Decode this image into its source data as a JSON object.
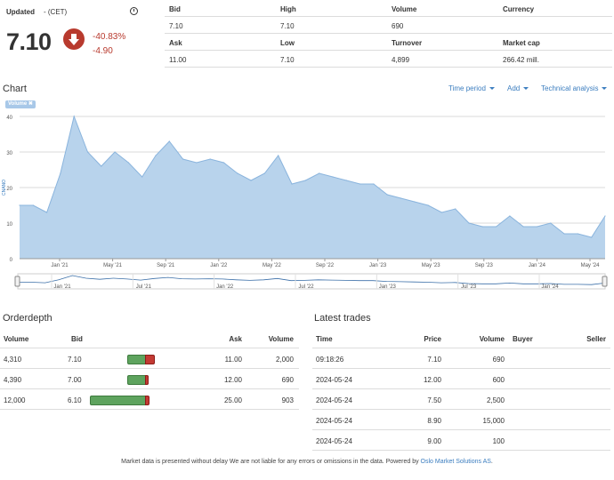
{
  "quote": {
    "updated_label": "Updated",
    "timezone": "- (CET)",
    "last": "7.10",
    "change_pct": "-40.83%",
    "change_abs": "-4.90",
    "headers_1": [
      "Bid",
      "High",
      "Volume",
      "Currency"
    ],
    "values_1": [
      "7.10",
      "7.10",
      "690",
      ""
    ],
    "headers_2": [
      "Ask",
      "Low",
      "Turnover",
      "Market cap"
    ],
    "values_2": [
      "11.00",
      "7.10",
      "4,899",
      "266.42 mill."
    ],
    "down_color": "#b83a2e"
  },
  "chart_section": {
    "title": "Chart",
    "time_period": "Time period",
    "add": "Add",
    "technical_analysis": "Technical analysis",
    "volume_tag": "Volume ✖"
  },
  "chart_data": {
    "type": "area",
    "ylabel": "CNANO",
    "ylim": [
      0,
      40
    ],
    "yticks": [
      0,
      10,
      20,
      30,
      40
    ],
    "x_tick_labels": [
      "Jan '21",
      "May '21",
      "Sep '21",
      "Jan '22",
      "May '22",
      "Sep '22",
      "Jan '23",
      "May '23",
      "Sep '23",
      "Jan '24",
      "May '24"
    ],
    "nav_tick_labels": [
      "Jan '21",
      "Jul '21",
      "Jan '22",
      "Jul '22",
      "Jan '23",
      "Jul '23",
      "Jan '24"
    ],
    "x": [
      "2020-10",
      "2020-11",
      "2020-12",
      "2021-01",
      "2021-02",
      "2021-03",
      "2021-04",
      "2021-05",
      "2021-06",
      "2021-07",
      "2021-08",
      "2021-09",
      "2021-10",
      "2021-11",
      "2021-12",
      "2022-01",
      "2022-02",
      "2022-03",
      "2022-04",
      "2022-05",
      "2022-06",
      "2022-07",
      "2022-08",
      "2022-09",
      "2022-10",
      "2022-11",
      "2022-12",
      "2023-01",
      "2023-02",
      "2023-03",
      "2023-04",
      "2023-05",
      "2023-06",
      "2023-07",
      "2023-08",
      "2023-09",
      "2023-10",
      "2023-11",
      "2023-12",
      "2024-01",
      "2024-02",
      "2024-03",
      "2024-04",
      "2024-05"
    ],
    "values": [
      15,
      15,
      13,
      24,
      40,
      30,
      26,
      30,
      27,
      23,
      29,
      33,
      28,
      27,
      28,
      27,
      24,
      22,
      24,
      29,
      21,
      22,
      24,
      23,
      22,
      21,
      21,
      18,
      17,
      16,
      15,
      13,
      14,
      10,
      9,
      9,
      12,
      9,
      9,
      10,
      7,
      7,
      6,
      12
    ],
    "fill_color": "#b8d3ec",
    "line_color": "#8ab4dd"
  },
  "orderdepth": {
    "title": "Orderdepth",
    "headers": [
      "Volume",
      "Bid",
      "Ask",
      "Volume"
    ],
    "rows": [
      {
        "bid_volume": "4,310",
        "bid": "7.10",
        "ask": "11.00",
        "ask_volume": "2,000",
        "bid_frac": 0.36,
        "ask_frac": 0.17
      },
      {
        "bid_volume": "4,390",
        "bid": "7.00",
        "ask": "12.00",
        "ask_volume": "690",
        "bid_frac": 0.36,
        "ask_frac": 0.06
      },
      {
        "bid_volume": "12,000",
        "bid": "6.10",
        "ask": "25.00",
        "ask_volume": "903",
        "bid_frac": 1.0,
        "ask_frac": 0.08
      }
    ]
  },
  "latest_trades": {
    "title": "Latest trades",
    "headers": [
      "Time",
      "Price",
      "Volume",
      "Buyer",
      "Seller"
    ],
    "rows": [
      {
        "time": "09:18:26",
        "price": "7.10",
        "volume": "690"
      },
      {
        "time": "2024-05-24",
        "price": "12.00",
        "volume": "600"
      },
      {
        "time": "2024-05-24",
        "price": "7.50",
        "volume": "2,500"
      },
      {
        "time": "2024-05-24",
        "price": "8.90",
        "volume": "15,000"
      },
      {
        "time": "2024-05-24",
        "price": "9.00",
        "volume": "100"
      }
    ]
  },
  "footer": {
    "text": "Market data is presented without delay We are not liable for any errors or omissions in the data. Powered by ",
    "link": "Oslo Market Solutions AS",
    "end": "."
  }
}
